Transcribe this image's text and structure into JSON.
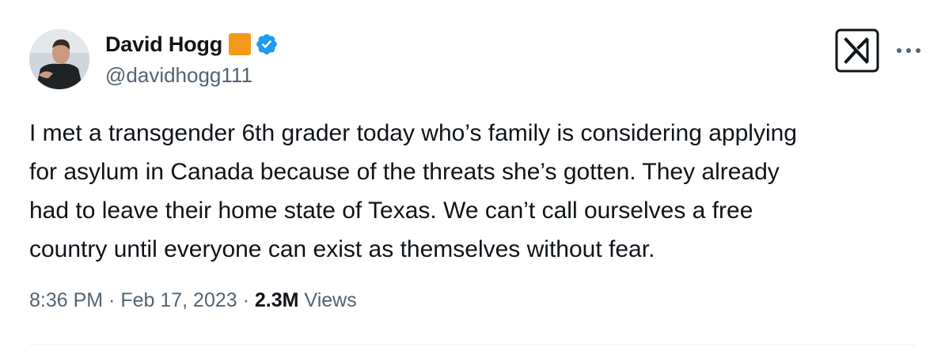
{
  "author": {
    "display_name": "David Hogg",
    "handle": "@davidhogg111",
    "verified": true,
    "affiliation_badge_color": "#f49a1a",
    "verified_badge_color": "#1d9bf0",
    "avatar_icon": "profile-photo"
  },
  "tweet": {
    "text": "I met a transgender 6th grader today who’s family is considering applying\nfor asylum in Canada because of the threats she’s gotten. They already\nhad to leave their home state of Texas. We can’t call ourselves a free\ncountry until everyone can exist as themselves without fear.",
    "time": "8:36 PM",
    "separator": " · ",
    "date": "Feb 17, 2023",
    "views_count": "2.3M",
    "views_label": "Views"
  },
  "icons": {
    "logo": "x-logo-icon",
    "more": "more-options-icon"
  },
  "colors": {
    "text_primary": "#0f1419",
    "text_secondary": "#536471",
    "divider": "#eff3f4"
  }
}
